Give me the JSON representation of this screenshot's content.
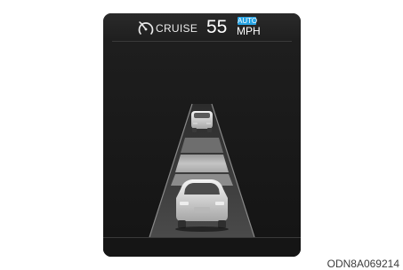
{
  "cruise": {
    "label": "CRUISE",
    "set_speed": "55",
    "mode_badge": "AUTO",
    "unit": "MPH",
    "icon": "cruise-speedometer-icon"
  },
  "scene": {
    "lead_vehicle_icon": "car-rear-icon",
    "own_vehicle_icon": "car-rear-icon",
    "following_gap": "gap-bar"
  },
  "figure_code": "ODN8A069214",
  "colors": {
    "background": "#1b1b1b",
    "badge": "#27a3e3",
    "text": "#ffffff"
  }
}
